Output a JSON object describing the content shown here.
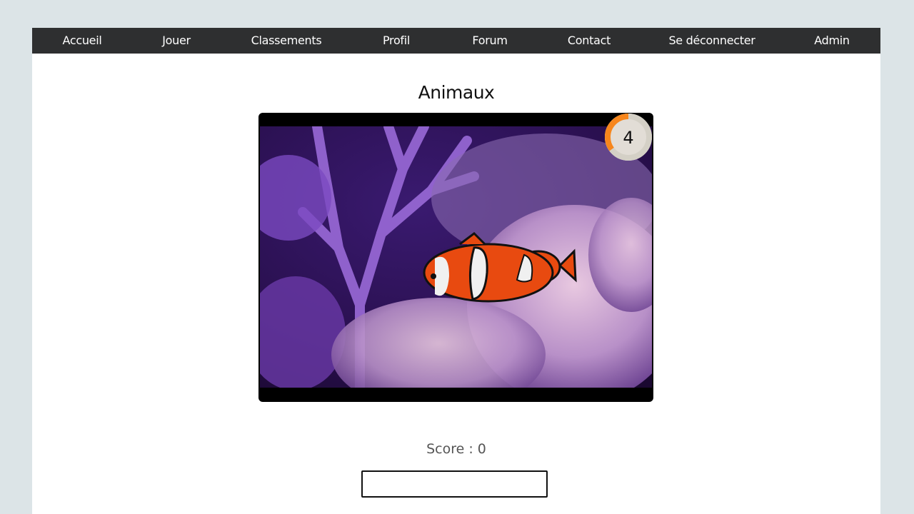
{
  "nav": {
    "items": [
      {
        "label": "Accueil"
      },
      {
        "label": "Jouer"
      },
      {
        "label": "Classements"
      },
      {
        "label": "Profil"
      },
      {
        "label": "Forum"
      },
      {
        "label": "Contact"
      },
      {
        "label": "Se déconnecter"
      },
      {
        "label": "Admin"
      }
    ]
  },
  "quiz": {
    "category": "Animaux",
    "timer": {
      "value": "4",
      "remaining_fraction": 0.35,
      "color": "#f7861c"
    },
    "image": {
      "subject": "clownfish-on-coral"
    },
    "score_label": "Score : 0",
    "answer": {
      "value": "",
      "placeholder": ""
    }
  }
}
